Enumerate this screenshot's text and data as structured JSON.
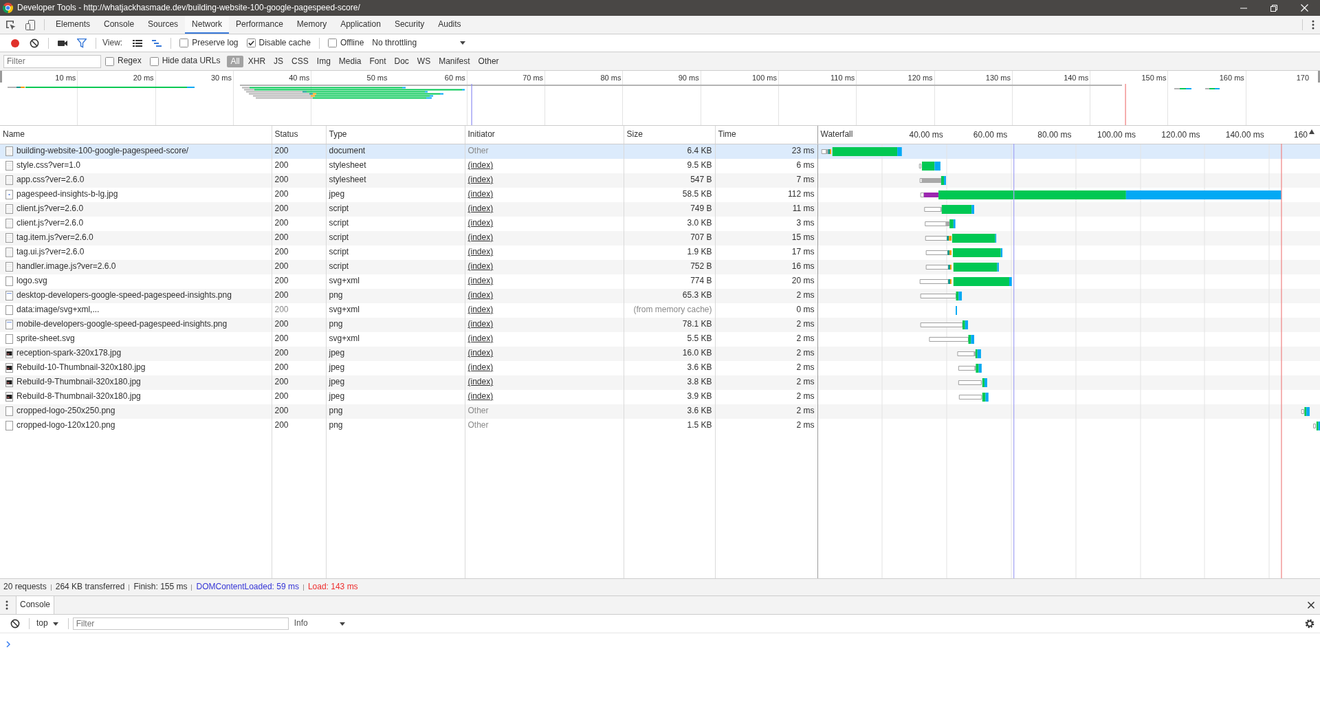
{
  "window": {
    "title": "Developer Tools - http://whatjackhasmade.dev/building-website-100-google-pagespeed-score/"
  },
  "panel_tabs": [
    {
      "label": "Elements",
      "selected": false
    },
    {
      "label": "Console",
      "selected": false
    },
    {
      "label": "Sources",
      "selected": false
    },
    {
      "label": "Network",
      "selected": true
    },
    {
      "label": "Performance",
      "selected": false
    },
    {
      "label": "Memory",
      "selected": false
    },
    {
      "label": "Application",
      "selected": false
    },
    {
      "label": "Security",
      "selected": false
    },
    {
      "label": "Audits",
      "selected": false
    }
  ],
  "toolbar": {
    "recording": true,
    "filter_shown": true,
    "view_label": "View:",
    "view_modes": [
      {
        "kind": "list",
        "on": false
      },
      {
        "kind": "overview",
        "on": true
      }
    ],
    "options": [
      {
        "label": "Preserve log",
        "checked": false
      },
      {
        "label": "Disable cache",
        "checked": true
      }
    ],
    "offline": {
      "label": "Offline",
      "checked": false
    },
    "throttling": "No throttling"
  },
  "filter_bar": {
    "filter": {
      "placeholder": "Filter"
    },
    "options": [
      {
        "label": "Regex",
        "checked": false
      },
      {
        "label": "Hide data URLs",
        "checked": false
      }
    ],
    "types": [
      {
        "label": "All",
        "selected": true
      },
      {
        "label": "XHR",
        "selected": false
      },
      {
        "label": "JS",
        "selected": false
      },
      {
        "label": "CSS",
        "selected": false
      },
      {
        "label": "Img",
        "selected": false
      },
      {
        "label": "Media",
        "selected": false
      },
      {
        "label": "Font",
        "selected": false
      },
      {
        "label": "Doc",
        "selected": false
      },
      {
        "label": "WS",
        "selected": false
      },
      {
        "label": "Manifest",
        "selected": false
      },
      {
        "label": "Other",
        "selected": false
      }
    ]
  },
  "overview": {
    "ticks": [
      "10 ms",
      "20 ms",
      "30 ms",
      "40 ms",
      "50 ms",
      "60 ms",
      "70 ms",
      "80 ms",
      "90 ms",
      "100 ms",
      "110 ms",
      "120 ms",
      "130 ms",
      "140 ms",
      "150 ms",
      "160 ms",
      "170"
    ]
  },
  "table": {
    "columns": [
      "Name",
      "Status",
      "Type",
      "Initiator",
      "Size",
      "Time",
      "Waterfall"
    ],
    "waterfall_ticks": [
      "40.00 ms",
      "60.00 ms",
      "80.00 ms",
      "100.00 ms",
      "120.00 ms",
      "140.00 ms",
      "160"
    ],
    "rows": [
      {
        "kind": "code",
        "name": "building-website-100-google-pagespeed-score/",
        "status": "200",
        "type": "document",
        "initiator": "Other",
        "initiator_link": false,
        "size": "6.4 KB",
        "time": "23 ms",
        "from_cache": false,
        "selected": true
      },
      {
        "kind": "code",
        "name": "style.css?ver=1.0",
        "status": "200",
        "type": "stylesheet",
        "initiator": "(index)",
        "initiator_link": true,
        "size": "9.5 KB",
        "time": "6 ms",
        "from_cache": false,
        "selected": false
      },
      {
        "kind": "code",
        "name": "app.css?ver=2.6.0",
        "status": "200",
        "type": "stylesheet",
        "initiator": "(index)",
        "initiator_link": true,
        "size": "547 B",
        "time": "7 ms",
        "from_cache": false,
        "selected": false
      },
      {
        "kind": "photo",
        "name": "pagespeed-insights-b-lg.jpg",
        "status": "200",
        "type": "jpeg",
        "initiator": "(index)",
        "initiator_link": true,
        "size": "58.5 KB",
        "time": "112 ms",
        "from_cache": false,
        "selected": false
      },
      {
        "kind": "code",
        "name": "client.js?ver=2.6.0",
        "status": "200",
        "type": "script",
        "initiator": "(index)",
        "initiator_link": true,
        "size": "749 B",
        "time": "11 ms",
        "from_cache": false,
        "selected": false
      },
      {
        "kind": "code",
        "name": "client.js?ver=2.6.0",
        "status": "200",
        "type": "script",
        "initiator": "(index)",
        "initiator_link": true,
        "size": "3.0 KB",
        "time": "3 ms",
        "from_cache": false,
        "selected": false
      },
      {
        "kind": "code",
        "name": "tag.item.js?ver=2.6.0",
        "status": "200",
        "type": "script",
        "initiator": "(index)",
        "initiator_link": true,
        "size": "707 B",
        "time": "15 ms",
        "from_cache": false,
        "selected": false
      },
      {
        "kind": "code",
        "name": "tag.ui.js?ver=2.6.0",
        "status": "200",
        "type": "script",
        "initiator": "(index)",
        "initiator_link": true,
        "size": "1.9 KB",
        "time": "17 ms",
        "from_cache": false,
        "selected": false
      },
      {
        "kind": "code",
        "name": "handler.image.js?ver=2.6.0",
        "status": "200",
        "type": "script",
        "initiator": "(index)",
        "initiator_link": true,
        "size": "752 B",
        "time": "16 ms",
        "from_cache": false,
        "selected": false
      },
      {
        "kind": "blank",
        "name": "logo.svg",
        "status": "200",
        "type": "svg+xml",
        "initiator": "(index)",
        "initiator_link": true,
        "size": "774 B",
        "time": "20 ms",
        "from_cache": false,
        "selected": false
      },
      {
        "kind": "banner",
        "name": "desktop-developers-google-speed-pagespeed-insights.png",
        "status": "200",
        "type": "png",
        "initiator": "(index)",
        "initiator_link": true,
        "size": "65.3 KB",
        "time": "2 ms",
        "from_cache": false,
        "selected": false
      },
      {
        "kind": "blank",
        "name": "data:image/svg+xml,...",
        "status": "200",
        "type": "svg+xml",
        "initiator": "(index)",
        "initiator_link": true,
        "size": "(from memory cache)",
        "time": "0 ms",
        "from_cache": true,
        "selected": false
      },
      {
        "kind": "banner",
        "name": "mobile-developers-google-speed-pagespeed-insights.png",
        "status": "200",
        "type": "png",
        "initiator": "(index)",
        "initiator_link": true,
        "size": "78.1 KB",
        "time": "2 ms",
        "from_cache": false,
        "selected": false
      },
      {
        "kind": "blank",
        "name": "sprite-sheet.svg",
        "status": "200",
        "type": "svg+xml",
        "initiator": "(index)",
        "initiator_link": true,
        "size": "5.5 KB",
        "time": "2 ms",
        "from_cache": false,
        "selected": false
      },
      {
        "kind": "thumbnail",
        "name": "reception-spark-320x178.jpg",
        "status": "200",
        "type": "jpeg",
        "initiator": "(index)",
        "initiator_link": true,
        "size": "16.0 KB",
        "time": "2 ms",
        "from_cache": false,
        "selected": false
      },
      {
        "kind": "thumbnail",
        "name": "Rebuild-10-Thumbnail-320x180.jpg",
        "status": "200",
        "type": "jpeg",
        "initiator": "(index)",
        "initiator_link": true,
        "size": "3.6 KB",
        "time": "2 ms",
        "from_cache": false,
        "selected": false
      },
      {
        "kind": "thumbnail",
        "name": "Rebuild-9-Thumbnail-320x180.jpg",
        "status": "200",
        "type": "jpeg",
        "initiator": "(index)",
        "initiator_link": true,
        "size": "3.8 KB",
        "time": "2 ms",
        "from_cache": false,
        "selected": false
      },
      {
        "kind": "thumbnail",
        "name": "Rebuild-8-Thumbnail-320x180.jpg",
        "status": "200",
        "type": "jpeg",
        "initiator": "(index)",
        "initiator_link": true,
        "size": "3.9 KB",
        "time": "2 ms",
        "from_cache": false,
        "selected": false
      },
      {
        "kind": "blank",
        "name": "cropped-logo-250x250.png",
        "status": "200",
        "type": "png",
        "initiator": "Other",
        "initiator_link": false,
        "size": "3.6 KB",
        "time": "2 ms",
        "from_cache": false,
        "selected": false
      },
      {
        "kind": "blank",
        "name": "cropped-logo-120x120.png",
        "status": "200",
        "type": "png",
        "initiator": "Other",
        "initiator_link": false,
        "size": "1.5 KB",
        "time": "2 ms",
        "from_cache": false,
        "selected": false
      }
    ]
  },
  "status_bar": {
    "items": [
      {
        "text": "20 requests",
        "color": "#333333"
      },
      {
        "text": "264 KB transferred",
        "color": "#333333"
      },
      {
        "text": "Finish: 155 ms",
        "color": "#333333"
      },
      {
        "text": "DOMContentLoaded: 59 ms",
        "color": "#3535d6"
      },
      {
        "text": "Load: 143 ms",
        "color": "#ee2d2d"
      }
    ]
  },
  "drawer": {
    "tabs": [
      {
        "label": "Console",
        "selected": true
      }
    ],
    "console": {
      "context": "top",
      "filter": {
        "placeholder": "Filter"
      },
      "level": "Info"
    }
  }
}
